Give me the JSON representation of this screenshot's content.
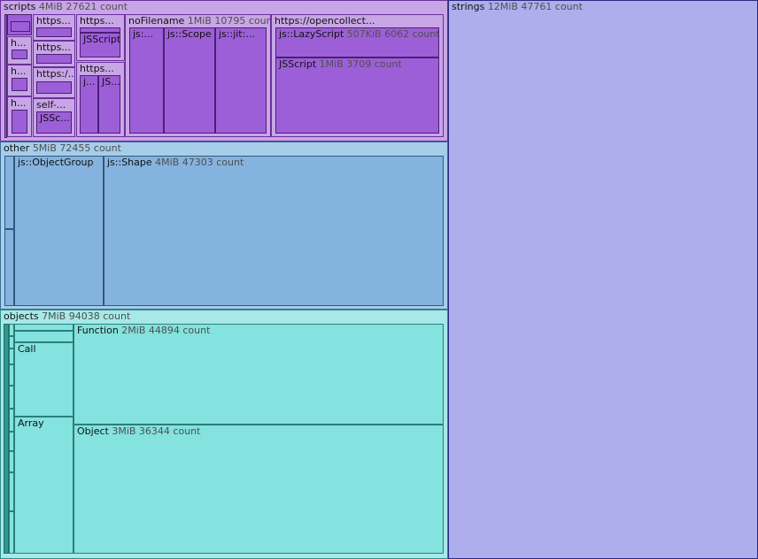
{
  "treemap": {
    "scripts": {
      "name": "scripts",
      "size": "4MiB",
      "count": "27621 count",
      "children": {
        "https_a": "https...",
        "https_b": "https...",
        "https_c": "https:/...",
        "self": "self-...",
        "self_child": "JSSc...",
        "h1": "h...",
        "h2": "h...",
        "h3": "h...",
        "https_d": "https...",
        "https_d_child": "JSScript",
        "https_e": "https...",
        "https_e_a": "j...",
        "https_e_b": "JS...",
        "nofile": {
          "name": "noFilename",
          "size": "1MiB",
          "count": "10795 count"
        },
        "nofile_a": "js:...",
        "nofile_b": "js::Scope",
        "nofile_c": "js::jit:...",
        "opencollect": "https://opencollect...",
        "lazy": {
          "name": "js::LazyScript",
          "size": "507KiB",
          "count": "6062 count"
        },
        "jsscript": {
          "name": "JSScript",
          "size": "1MiB",
          "count": "3709 count"
        }
      }
    },
    "other": {
      "name": "other",
      "size": "5MiB",
      "count": "72455 count",
      "objectgroup": "js::ObjectGroup",
      "shape": {
        "name": "js::Shape",
        "size": "4MiB",
        "count": "47303 count"
      }
    },
    "objects": {
      "name": "objects",
      "size": "7MiB",
      "count": "94038 count",
      "call": "Call",
      "array": "Array",
      "function": {
        "name": "Function",
        "size": "2MiB",
        "count": "44894 count"
      },
      "object": {
        "name": "Object",
        "size": "3MiB",
        "count": "36344 count"
      }
    },
    "strings": {
      "name": "strings",
      "size": "12MiB",
      "count": "47761 count"
    }
  }
}
